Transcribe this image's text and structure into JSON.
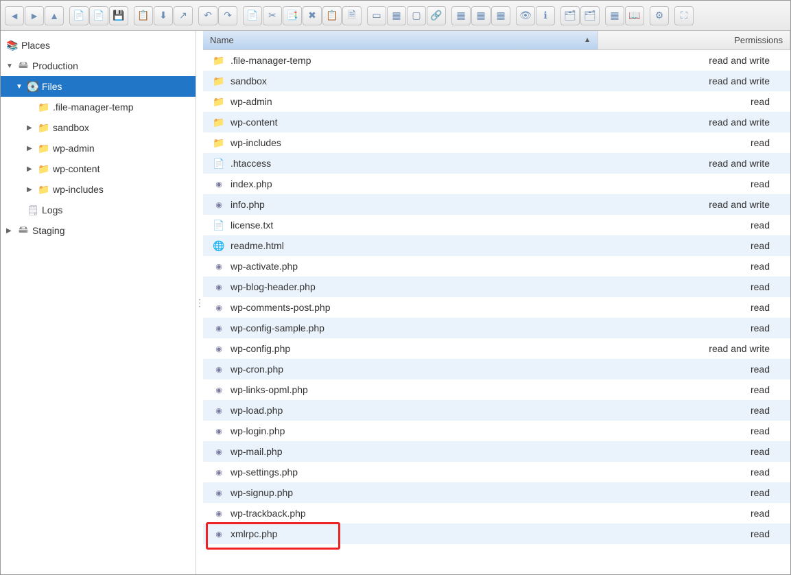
{
  "toolbar": {
    "groups": [
      [
        "back-icon",
        "forward-icon",
        "up-icon"
      ],
      [
        "new-folder-icon",
        "upload-icon",
        "save-icon"
      ],
      [
        "copy-path-icon",
        "download-icon",
        "pointer-icon"
      ],
      [
        "undo-icon",
        "redo-icon"
      ],
      [
        "new-file-icon",
        "cut-icon",
        "copy-icon",
        "delete-icon",
        "paste-icon",
        "duplicate-icon"
      ],
      [
        "select-icon",
        "select-all-icon",
        "deselect-icon",
        "link-icon"
      ],
      [
        "grid-large-icon",
        "grid-small-icon",
        "grid-mixed-icon"
      ],
      [
        "preview-icon",
        "info-icon"
      ],
      [
        "sort-asc-icon",
        "sort-desc-icon"
      ],
      [
        "apps-icon",
        "book-icon"
      ],
      [
        "settings-icon"
      ],
      [
        "fullscreen-icon"
      ]
    ]
  },
  "sidebar": {
    "places_label": "Places",
    "tree": [
      {
        "label": "Production",
        "icon": "server-icon",
        "expanded": true,
        "indent": 0
      },
      {
        "label": "Files",
        "icon": "hd-icon",
        "expanded": true,
        "selected": true,
        "indent": 1
      },
      {
        "label": ".file-manager-temp",
        "icon": "folder-ic",
        "indent": 2
      },
      {
        "label": "sandbox",
        "icon": "folder-ic",
        "indent": 2,
        "has_children": true
      },
      {
        "label": "wp-admin",
        "icon": "folder-ic",
        "indent": 2,
        "has_children": true
      },
      {
        "label": "wp-content",
        "icon": "folder-ic",
        "indent": 2,
        "has_children": true
      },
      {
        "label": "wp-includes",
        "icon": "folder-ic",
        "indent": 2,
        "has_children": true
      },
      {
        "label": "Logs",
        "icon": "logs-icon",
        "indent": 1
      },
      {
        "label": "Staging",
        "icon": "server-icon",
        "indent": 0,
        "has_children": true
      }
    ]
  },
  "filelist": {
    "columns": {
      "name": "Name",
      "permissions": "Permissions"
    },
    "rows": [
      {
        "name": ".file-manager-temp",
        "type": "folder",
        "perm": "read and write"
      },
      {
        "name": "sandbox",
        "type": "folder",
        "perm": "read and write"
      },
      {
        "name": "wp-admin",
        "type": "folder",
        "perm": "read"
      },
      {
        "name": "wp-content",
        "type": "folder",
        "perm": "read and write"
      },
      {
        "name": "wp-includes",
        "type": "folder",
        "perm": "read"
      },
      {
        "name": ".htaccess",
        "type": "txt",
        "perm": "read and write"
      },
      {
        "name": "index.php",
        "type": "php",
        "perm": "read"
      },
      {
        "name": "info.php",
        "type": "php",
        "perm": "read and write"
      },
      {
        "name": "license.txt",
        "type": "txt",
        "perm": "read"
      },
      {
        "name": "readme.html",
        "type": "html",
        "perm": "read"
      },
      {
        "name": "wp-activate.php",
        "type": "php",
        "perm": "read"
      },
      {
        "name": "wp-blog-header.php",
        "type": "php",
        "perm": "read"
      },
      {
        "name": "wp-comments-post.php",
        "type": "php",
        "perm": "read"
      },
      {
        "name": "wp-config-sample.php",
        "type": "php",
        "perm": "read"
      },
      {
        "name": "wp-config.php",
        "type": "php",
        "perm": "read and write"
      },
      {
        "name": "wp-cron.php",
        "type": "php",
        "perm": "read"
      },
      {
        "name": "wp-links-opml.php",
        "type": "php",
        "perm": "read"
      },
      {
        "name": "wp-load.php",
        "type": "php",
        "perm": "read"
      },
      {
        "name": "wp-login.php",
        "type": "php",
        "perm": "read"
      },
      {
        "name": "wp-mail.php",
        "type": "php",
        "perm": "read"
      },
      {
        "name": "wp-settings.php",
        "type": "php",
        "perm": "read"
      },
      {
        "name": "wp-signup.php",
        "type": "php",
        "perm": "read"
      },
      {
        "name": "wp-trackback.php",
        "type": "php",
        "perm": "read"
      },
      {
        "name": "xmlrpc.php",
        "type": "php",
        "perm": "read",
        "highlighted": true
      }
    ]
  },
  "icons": {
    "back-icon": "◄",
    "forward-icon": "►",
    "up-icon": "▲",
    "new-folder-icon": "📄",
    "upload-icon": "📄",
    "save-icon": "💾",
    "copy-path-icon": "📋",
    "download-icon": "⬇",
    "pointer-icon": "↗",
    "undo-icon": "↶",
    "redo-icon": "↷",
    "new-file-icon": "📄",
    "cut-icon": "✂",
    "copy-icon": "📑",
    "delete-icon": "✖",
    "paste-icon": "📋",
    "duplicate-icon": "🗎",
    "select-icon": "▭",
    "select-all-icon": "▦",
    "deselect-icon": "▢",
    "link-icon": "🔗",
    "grid-large-icon": "▦",
    "grid-small-icon": "▦",
    "grid-mixed-icon": "▦",
    "preview-icon": "👁",
    "info-icon": "ℹ",
    "sort-asc-icon": "🗂",
    "sort-desc-icon": "🗂",
    "apps-icon": "▦",
    "book-icon": "📖",
    "settings-icon": "⚙",
    "fullscreen-icon": "⛶"
  }
}
